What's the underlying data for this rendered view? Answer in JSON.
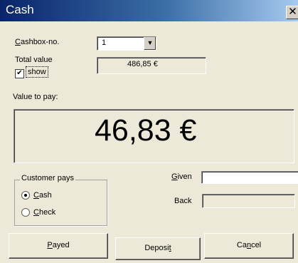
{
  "window": {
    "title": "Cash",
    "close_glyph": "✕"
  },
  "cashbox": {
    "label_first": "C",
    "label_rest": "ashbox-no.",
    "value": "1",
    "dropdown_icon": "chevron-down-icon"
  },
  "total": {
    "label": "Total value",
    "value": "486,85 €",
    "show_label": "show",
    "show_checked": true
  },
  "pay": {
    "label": "Value to pay:",
    "amount": "46,83 €"
  },
  "customer_pays": {
    "group_label": "Customer pays",
    "cash": {
      "first": "C",
      "rest": "ash",
      "selected": true
    },
    "check": {
      "first": "C",
      "rest": "heck",
      "selected": false
    }
  },
  "given": {
    "label_first": "G",
    "label_rest": "iven",
    "value": ""
  },
  "back": {
    "label": "Back",
    "value": ""
  },
  "buttons": {
    "payed_first": "P",
    "payed_rest": "ayed",
    "deposit_main": "Deposi",
    "deposit_u": "t",
    "cancel_main": "Ca",
    "cancel_u": "n",
    "cancel_rest": "cel"
  }
}
